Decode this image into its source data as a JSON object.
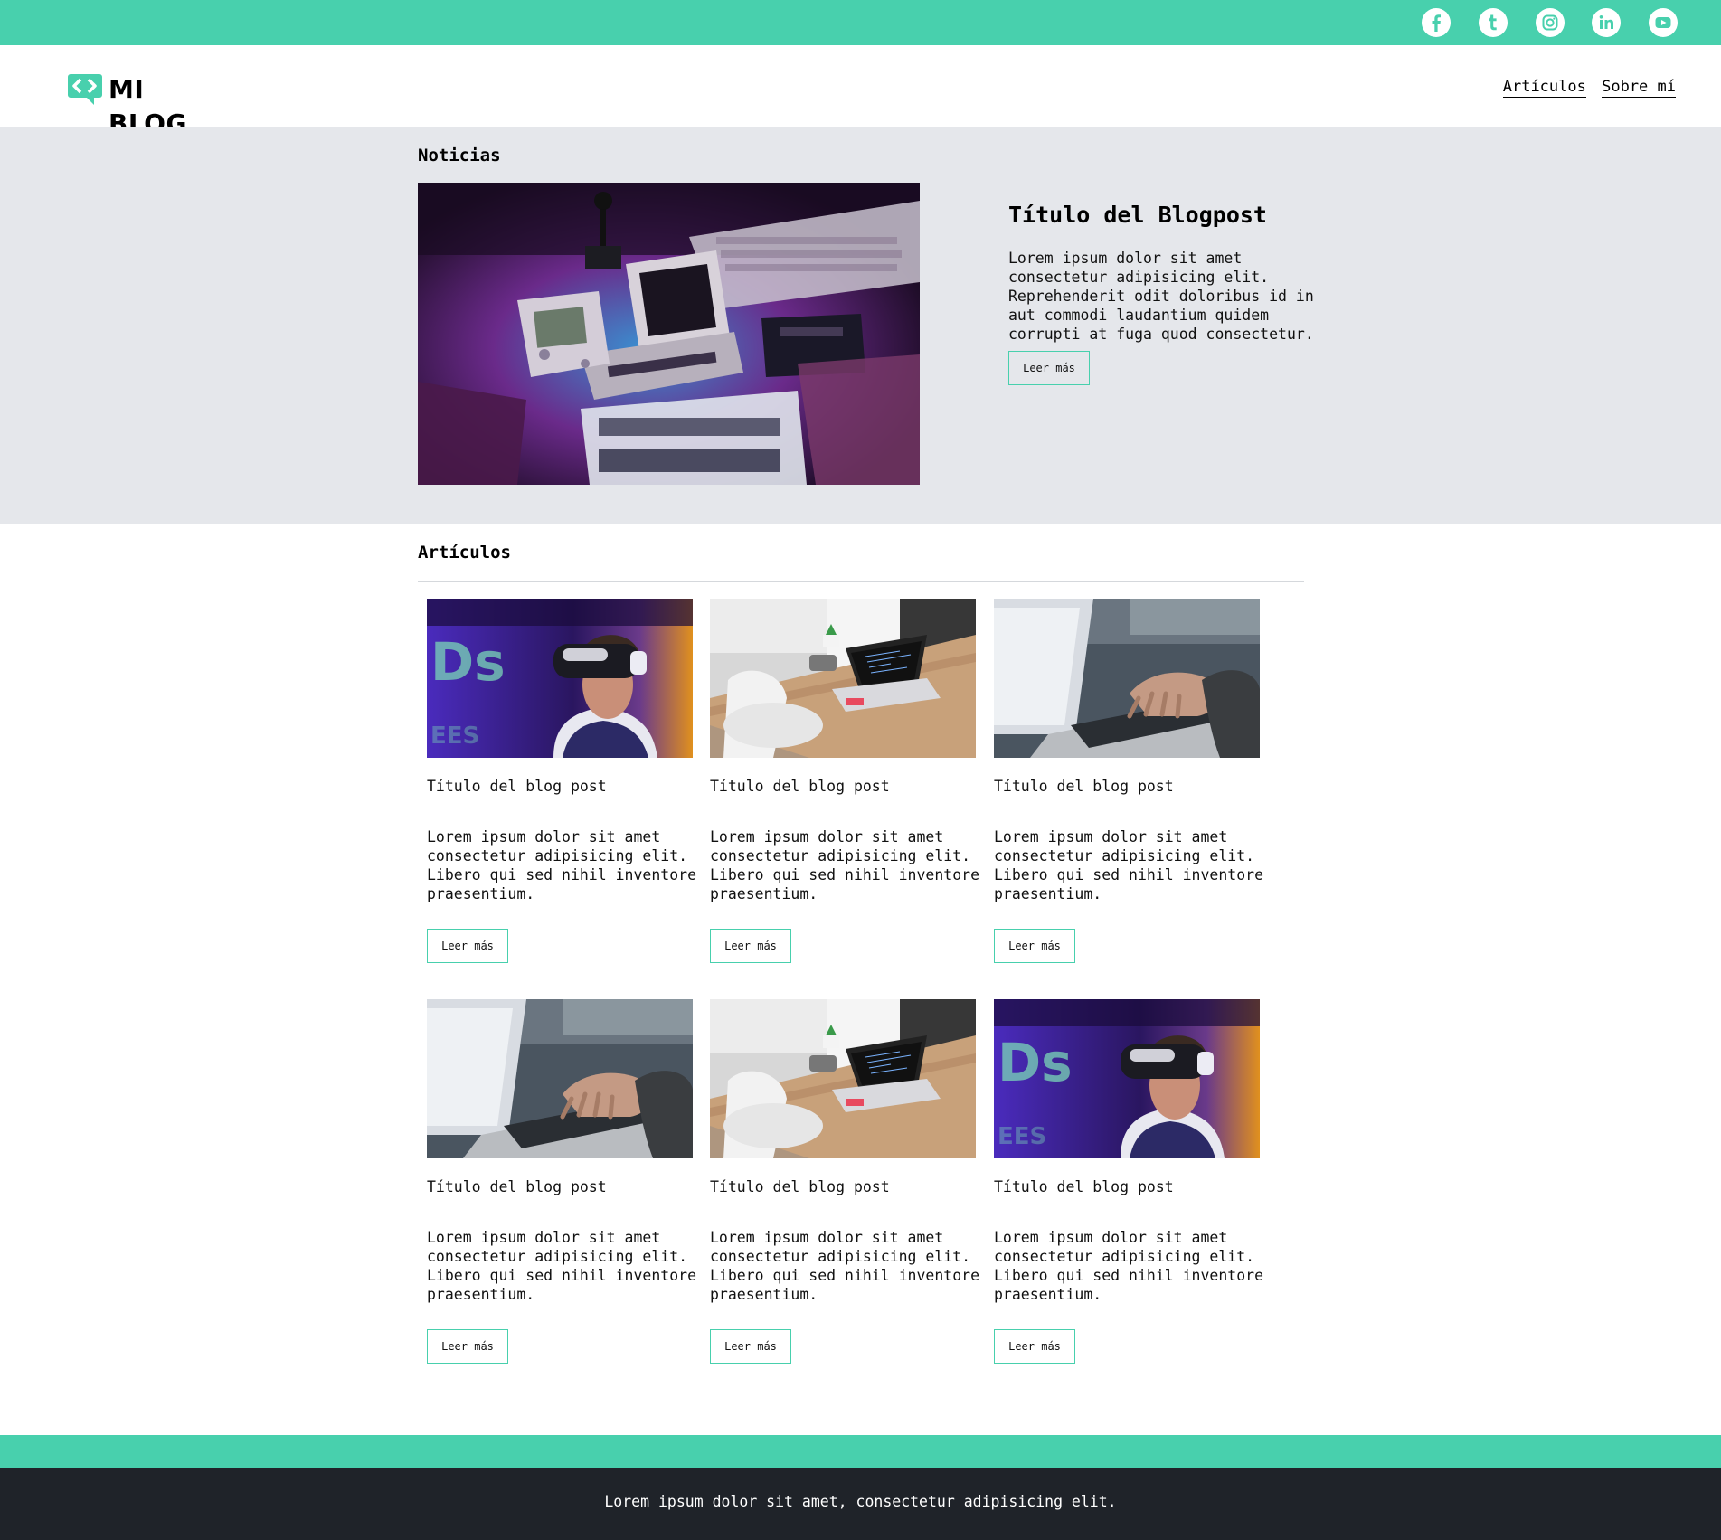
{
  "top_bar": {
    "accent_color": "#48d0ad",
    "social_icons": [
      "facebook-icon",
      "tumblr-icon",
      "instagram-icon",
      "linkedin-icon",
      "youtube-icon"
    ]
  },
  "header": {
    "logo_text": "MI BLOG",
    "nav": [
      "Artículos",
      "Sobre mí"
    ]
  },
  "noticias": {
    "section_title": "Noticias",
    "featured": {
      "title": "Título del Blogpost",
      "text": "Lorem ipsum dolor sit amet consectetur adipisicing elit. Reprehenderit odit doloribus id in aut commodi laudantium quidem corrupti at fuga quod consectetur.",
      "button": "Leer más"
    }
  },
  "articulos": {
    "section_title": "Artículos",
    "cards": [
      {
        "image": "vr-headset",
        "title": "Título del blog post",
        "text": "Lorem ipsum dolor sit amet consectetur adipisicing elit. Libero qui sed nihil inventore praesentium.",
        "button": "Leer más"
      },
      {
        "image": "laptop-desk",
        "title": "Título del blog post",
        "text": "Lorem ipsum dolor sit amet consectetur adipisicing elit. Libero qui sed nihil inventore praesentium.",
        "button": "Leer más"
      },
      {
        "image": "typing-laptop",
        "title": "Título del blog post",
        "text": "Lorem ipsum dolor sit amet consectetur adipisicing elit. Libero qui sed nihil inventore praesentium.",
        "button": "Leer más"
      },
      {
        "image": "typing-laptop",
        "title": "Título del blog post",
        "text": "Lorem ipsum dolor sit amet consectetur adipisicing elit. Libero qui sed nihil inventore praesentium.",
        "button": "Leer más"
      },
      {
        "image": "laptop-desk",
        "title": "Título del blog post",
        "text": "Lorem ipsum dolor sit amet consectetur adipisicing elit. Libero qui sed nihil inventore praesentium.",
        "button": "Leer más"
      },
      {
        "image": "vr-headset",
        "title": "Título del blog post",
        "text": "Lorem ipsum dolor sit amet consectetur adipisicing elit. Libero qui sed nihil inventore praesentium.",
        "button": "Leer más"
      }
    ]
  },
  "footer": {
    "text": "Lorem ipsum dolor sit amet, consectetur adipisicing elit."
  }
}
